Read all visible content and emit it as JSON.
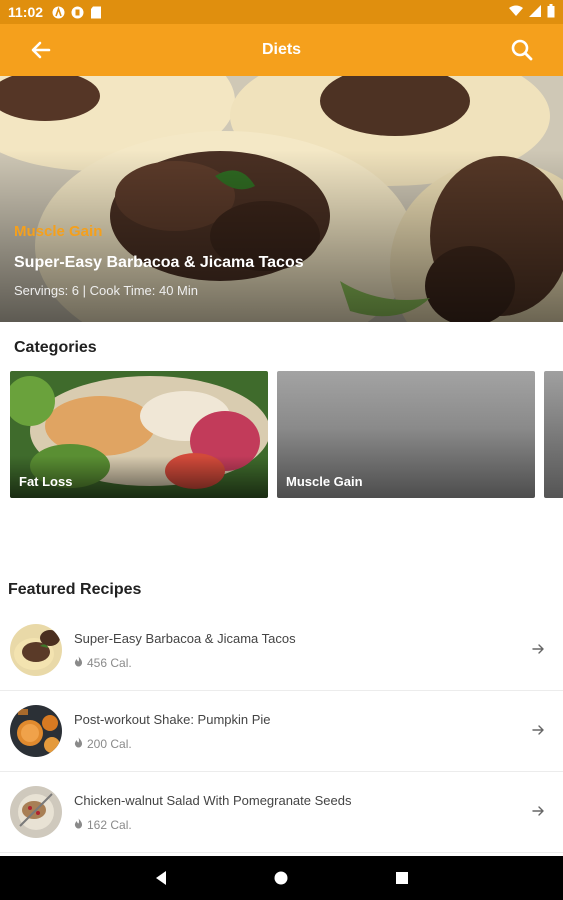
{
  "status_bar": {
    "time": "11:02"
  },
  "app_bar": {
    "title": "Diets",
    "back_icon": "arrow-left-icon",
    "search_icon": "search-icon"
  },
  "hero": {
    "category": "Muscle Gain",
    "title": "Super-Easy Barbacoa & Jicama Tacos",
    "meta": "Servings: 6 | Cook Time: 40 Min"
  },
  "categories": {
    "title": "Categories",
    "items": [
      {
        "label": "Fat Loss"
      },
      {
        "label": "Muscle Gain"
      },
      {
        "label": ""
      }
    ]
  },
  "featured": {
    "title": "Featured Recipes",
    "items": [
      {
        "title": "Super-Easy Barbacoa & Jicama Tacos",
        "calories": "456 Cal."
      },
      {
        "title": "Post-workout Shake: Pumpkin Pie",
        "calories": "200 Cal."
      },
      {
        "title": "Chicken-walnut Salad With Pomegranate Seeds",
        "calories": "162 Cal."
      }
    ]
  },
  "colors": {
    "accent": "#f5a01c",
    "status_bar": "#e08f0e"
  }
}
